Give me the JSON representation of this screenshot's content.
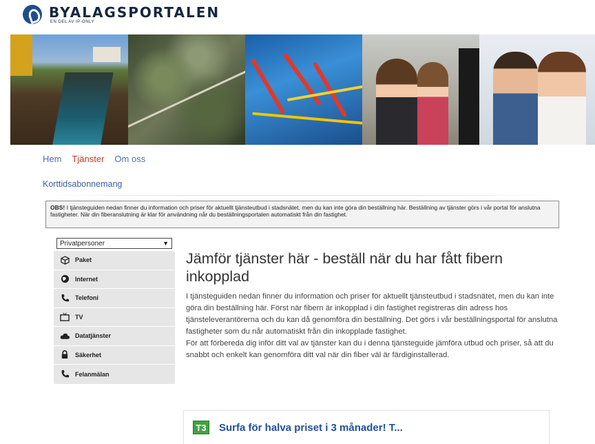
{
  "header": {
    "logo_title": "BYALAGSPORTALEN",
    "logo_subtitle": "EN DEL AV IP-ONLY"
  },
  "nav": {
    "items": [
      {
        "label": "Hem"
      },
      {
        "label": "Tjänster"
      },
      {
        "label": "Om oss"
      }
    ],
    "active": "Tjänster",
    "sub_item": "Korttidsabonnemang"
  },
  "notice": {
    "lead": "OBS!",
    "text": " I tjänsteguiden nedan finner du information och priser för aktuellt tjänsteutbud i stadsnätet, men du kan inte göra din beställning här. Beställning av tjänster görs i vår portal för anslutna fastigheter. När din fiberanslutning är klar för användning når du beställningsportalen automatiskt från din fastighet."
  },
  "sidebar": {
    "select_value": "Privatpersoner",
    "items": [
      {
        "label": "Paket",
        "icon": "box-icon"
      },
      {
        "label": "Internet",
        "icon": "globe-icon"
      },
      {
        "label": "Telefoni",
        "icon": "phone-icon"
      },
      {
        "label": "TV",
        "icon": "tv-icon"
      },
      {
        "label": "Datatjänster",
        "icon": "cloud-icon"
      },
      {
        "label": "Säkerhet",
        "icon": "lock-icon"
      },
      {
        "label": "Felanmälan",
        "icon": "phone-icon"
      }
    ]
  },
  "main": {
    "title": "Jämför tjänster här - beställ när du har fått fibern inkopplad",
    "paragraph1": "I tjänsteguiden nedan finner du information och priser för aktuellt tjänsteutbud i stadsnätet, men du kan inte göra din beställning här. Först när fibern är inkopplad i din fastighet registreras din adress hos tjänsteleverantörerna och du kan då genomföra din beställning. Det görs i vår beställningsportal för anslutna fastigheter som du når automatiskt från din inkopplade fastighet.",
    "paragraph2": "För att förbereda dig inför ditt val av tjänster kan du i denna tjänsteguide jämföra utbud och priser, så att du snabbt och enkelt kan genomföra ditt val när din fiber väl är färdiginstallerad."
  },
  "offer": {
    "logo_text": "T3",
    "text": "Surfa för halva priset i 3 månader! T..."
  }
}
